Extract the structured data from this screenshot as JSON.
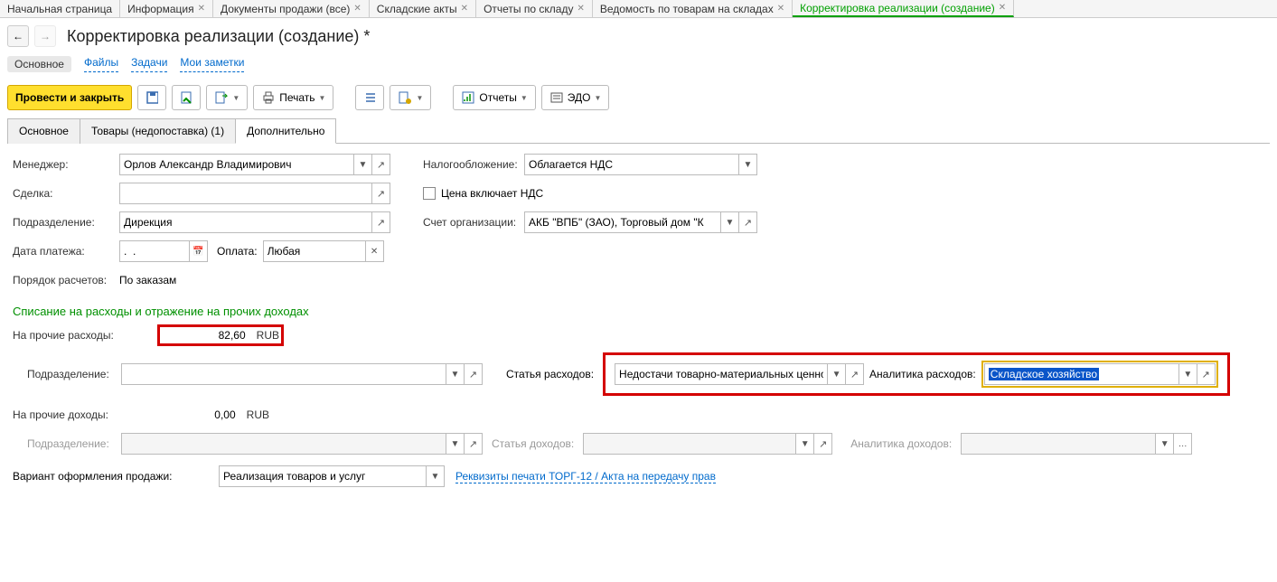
{
  "tabsTop": [
    {
      "label": "Начальная страница",
      "active": false,
      "close": false
    },
    {
      "label": "Информация",
      "active": false,
      "close": true
    },
    {
      "label": "Документы продажи (все)",
      "active": false,
      "close": true
    },
    {
      "label": "Складские акты",
      "active": false,
      "close": true
    },
    {
      "label": "Отчеты по складу",
      "active": false,
      "close": true
    },
    {
      "label": "Ведомость по товарам на складах",
      "active": false,
      "close": true
    },
    {
      "label": "Корректировка реализации (создание)",
      "active": true,
      "close": true
    }
  ],
  "pageTitle": "Корректировка реализации (создание) *",
  "subnav": {
    "main": "Основное",
    "files": "Файлы",
    "tasks": "Задачи",
    "notes": "Мои заметки"
  },
  "toolbar": {
    "postClose": "Провести и закрыть",
    "print": "Печать",
    "reports": "Отчеты",
    "edo": "ЭДО"
  },
  "formTabs": {
    "main": "Основное",
    "goods": "Товары (недопоставка) (1)",
    "extra": "Дополнительно"
  },
  "labels": {
    "manager": "Менеджер:",
    "deal": "Сделка:",
    "dept": "Подразделение:",
    "payDate": "Дата платежа:",
    "pay": "Оплата:",
    "calcOrder": "Порядок расчетов:",
    "tax": "Налогообложение:",
    "priceInclVat": "Цена включает НДС",
    "orgAcc": "Счет организации:",
    "section": "Списание на расходы и отражение на прочих доходах",
    "onExpenses": "На прочие расходы:",
    "onIncome": "На прочие доходы:",
    "subdept": "Подразделение:",
    "expItem": "Статья расходов:",
    "expAnalytics": "Аналитика расходов:",
    "incItem": "Статья доходов:",
    "incAnalytics": "Аналитика доходов:",
    "salesForm": "Вариант оформления продажи:",
    "torg12": "Реквизиты печати ТОРГ-12 / Акта на передачу прав"
  },
  "values": {
    "manager": "Орлов Александр Владимирович",
    "dept": "Дирекция",
    "payDate": ".  .",
    "pay": "Любая",
    "calcOrder": "По заказам",
    "tax": "Облагается НДС",
    "orgAcc": "АКБ \"ВПБ\" (ЗАО), Торговый дом \"К",
    "expAmount": "82,60",
    "expCur": "RUB",
    "expItem": "Недостачи товарно-материальных ценно",
    "expAnalytics": "Складское хозяйство",
    "incAmount": "0,00",
    "incCur": "RUB",
    "salesForm": "Реализация товаров и услуг"
  }
}
